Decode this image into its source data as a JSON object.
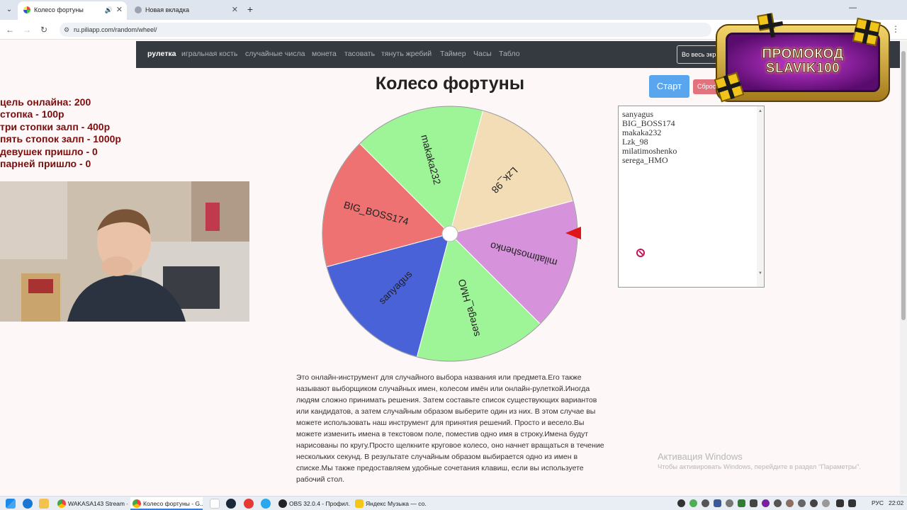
{
  "browser": {
    "tabs": [
      {
        "title": "Колесо фортуны",
        "active": true
      },
      {
        "title": "Новая вкладка",
        "active": false
      }
    ],
    "url": "ru.piliapp.com/random/wheel/"
  },
  "navbar": {
    "items": [
      "рулетка",
      "игральная кость",
      "случайные числа",
      "монета",
      "тасовать",
      "тянуть жребий",
      "Таймер",
      "Часы",
      "Табло"
    ],
    "fullscreen_label": "Во весь экран"
  },
  "page": {
    "title": "Колесо фортуны",
    "start_label": "Старт",
    "reset_label": "Сброс"
  },
  "wheel": {
    "segments": [
      {
        "label": "sanyagus",
        "color": "#4962d8"
      },
      {
        "label": "BIG_BOSS174",
        "color": "#ee7272"
      },
      {
        "label": "makaka232",
        "color": "#9ef598"
      },
      {
        "label": "Lzk_98",
        "color": "#f3ddb6"
      },
      {
        "label": "milatimoshenko",
        "color": "#d692db"
      },
      {
        "label": "serega_HMO",
        "color": "#9ef598"
      }
    ],
    "pointer_color": "#e0151b"
  },
  "names": [
    "sanyagus",
    "BIG_BOSS174",
    "makaka232",
    "Lzk_98",
    "milatimoshenko",
    "serega_HMO"
  ],
  "description": "Это онлайн-инструмент для случайного выбора названия или предмета.Его также называют выборщиком случайных имен, колесом имён или онлайн-рулеткой.Иногда людям сложно принимать решения. Затем составьте список существующих вариантов или кандидатов, а затем случайным образом выберите один из них. В этом случае вы можете использовать наш инструмент для принятия решений. Просто и весело.Вы можете изменить имена в текстовом поле, поместив одно имя в строку.Имена будут нарисованы по кругу.Просто щелкните круговое колесо, оно начнет вращаться в течение нескольких секунд. В результате случайным образом выбирается одно из имен в списке.Мы также предоставляем удобные сочетания клавиш, если вы используете рабочий стол.",
  "overlay": {
    "stats": [
      "цель онлайна: 200",
      "стопка - 100р",
      "три стопки залп - 400р",
      "пять стопок  залп - 1000р",
      "девушек пришло - 0",
      "парней пришло - 0"
    ],
    "promo_line1": "ПРОМОКОД",
    "promo_line2": "SLAVIK100"
  },
  "activation": {
    "title": "Активация Windows",
    "subtitle": "Чтобы активировать Windows, перейдите в раздел \"Параметры\"."
  },
  "taskbar": {
    "apps": [
      "WAKASA143 Stream -...",
      "Колесо фортуны - G...",
      "OBS 32.0.4 - Профил...",
      "Яндекс Музыка — со..."
    ],
    "lang": "РУС",
    "time": "22:02"
  }
}
